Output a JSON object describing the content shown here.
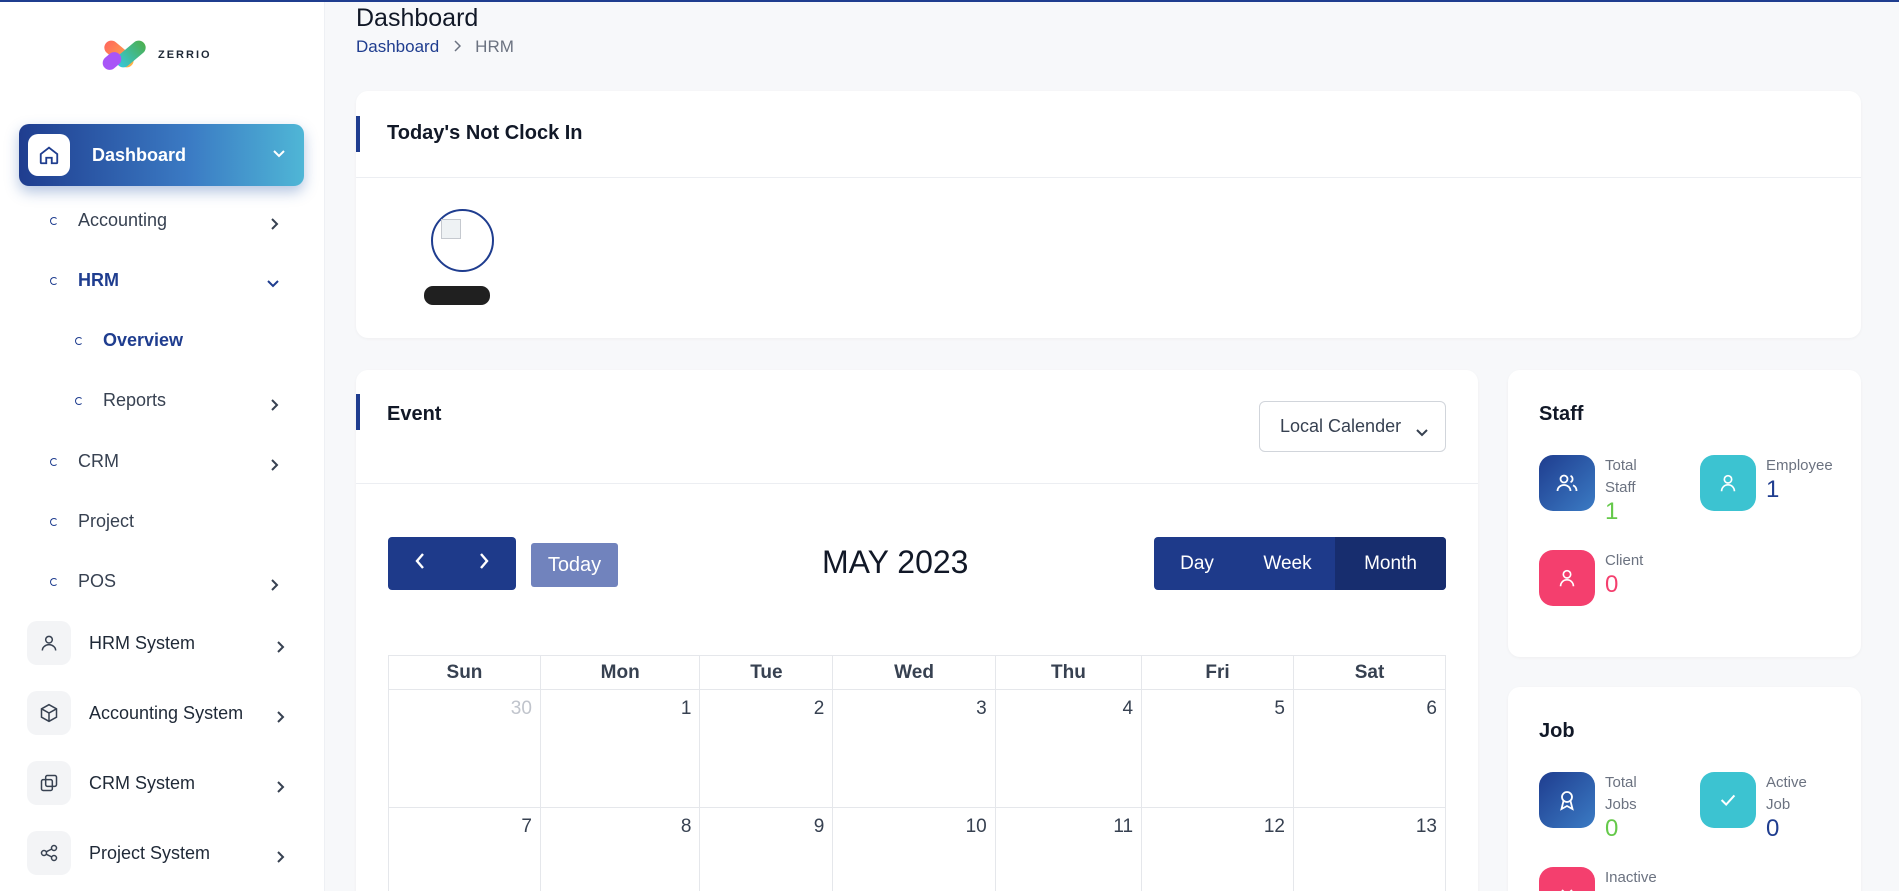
{
  "brand": {
    "name": "ZERRIO"
  },
  "colors": {
    "primary": "#1f3d8f",
    "cyan": "#3cc3d1",
    "pink": "#f43f6e",
    "green": "#65c94a"
  },
  "sidebar": {
    "active": {
      "label": "Dashboard",
      "icon": "home-icon"
    },
    "sub_items": [
      {
        "label": "Accounting"
      },
      {
        "label": "HRM"
      },
      {
        "label": "Overview"
      },
      {
        "label": "Reports"
      },
      {
        "label": "CRM"
      },
      {
        "label": "Project"
      },
      {
        "label": "POS"
      }
    ],
    "systems": [
      {
        "label": "HRM System",
        "icon": "user-icon"
      },
      {
        "label": "Accounting System",
        "icon": "box-icon"
      },
      {
        "label": "CRM System",
        "icon": "layers-icon"
      },
      {
        "label": "Project System",
        "icon": "share-icon"
      }
    ]
  },
  "header": {
    "title": "Dashboard",
    "breadcrumb": [
      "Dashboard",
      "HRM"
    ]
  },
  "not_clock_in": {
    "title": "Today's Not Clock In"
  },
  "event": {
    "title": "Event",
    "calendar_select": "Local Calender",
    "today_label": "Today",
    "month_title": "MAY 2023",
    "views": [
      "Day",
      "Week",
      "Month"
    ],
    "active_view": "Month",
    "weekdays": [
      "Sun",
      "Mon",
      "Tue",
      "Wed",
      "Thu",
      "Fri",
      "Sat"
    ],
    "weeks": [
      [
        "30",
        "1",
        "2",
        "3",
        "4",
        "5",
        "6"
      ],
      [
        "7",
        "8",
        "9",
        "10",
        "11",
        "12",
        "13"
      ]
    ]
  },
  "staff": {
    "title": "Staff",
    "total_staff_label": "Total Staff",
    "total_staff_value": "1",
    "employee_label": "Employee",
    "employee_value": "1",
    "client_label": "Client",
    "client_value": "0"
  },
  "job": {
    "title": "Job",
    "total_jobs_label": "Total Jobs",
    "total_jobs_value": "0",
    "active_job_label": "Active Job",
    "active_job_value": "0",
    "inactive_label": "Inactive"
  }
}
